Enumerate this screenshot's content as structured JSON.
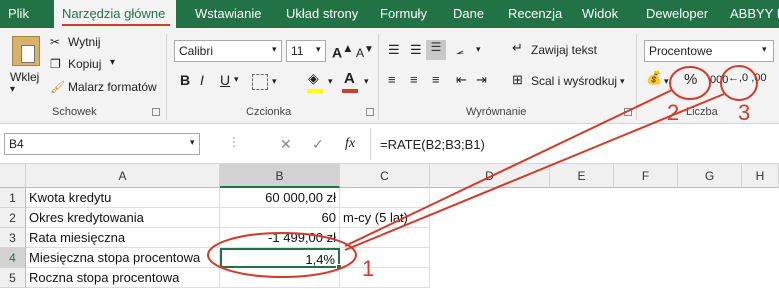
{
  "menu_tabs": [
    "Plik",
    "Narzędzia główne",
    "Wstawianie",
    "Układ strony",
    "Formuły",
    "Dane",
    "Recenzja",
    "Widok",
    "Deweloper",
    "ABBYY Fi"
  ],
  "clipboard": {
    "paste_label": "Wklej",
    "cut_label": "Wytnij",
    "copy_label": "Kopiuj",
    "painter_label": "Malarz formatów",
    "group_label": "Schowek"
  },
  "font": {
    "name": "Calibri",
    "size": "11",
    "bold": "B",
    "italic": "I",
    "underline": "U",
    "group_label": "Czcionka"
  },
  "alignment": {
    "wrap_label": "Zawijaj tekst",
    "merge_label": "Scal i wyśrodkuj",
    "group_label": "Wyrównanie"
  },
  "number": {
    "format": "Procentowe",
    "percent_symbol": "%",
    "thousands_symbol": "000",
    "increase_decimal": "←,0 ,00",
    "group_label": "Liczba"
  },
  "formula_bar": {
    "name_box": "B4",
    "fx": "fx",
    "formula": "=RATE(B2;B3;B1)"
  },
  "columns": [
    "A",
    "B",
    "C",
    "D",
    "E",
    "F",
    "G",
    "H"
  ],
  "rows": [
    {
      "num": "1",
      "a": "Kwota kredytu",
      "b": "60 000,00 zł",
      "c": ""
    },
    {
      "num": "2",
      "a": "Okres kredytowania",
      "b": "60",
      "c": "m-cy (5 lat)"
    },
    {
      "num": "3",
      "a": "Rata miesięczna",
      "b": "-1 499,00 zł",
      "c": ""
    },
    {
      "num": "4",
      "a": "Miesięczna stopa procentowa",
      "b": "1,4%",
      "c": ""
    },
    {
      "num": "5",
      "a": "Roczna stopa procentowa",
      "b": "",
      "c": ""
    }
  ],
  "annotations": [
    "1",
    "2",
    "3"
  ],
  "colors": {
    "brand": "#217346",
    "annotation": "#d23b2a"
  }
}
